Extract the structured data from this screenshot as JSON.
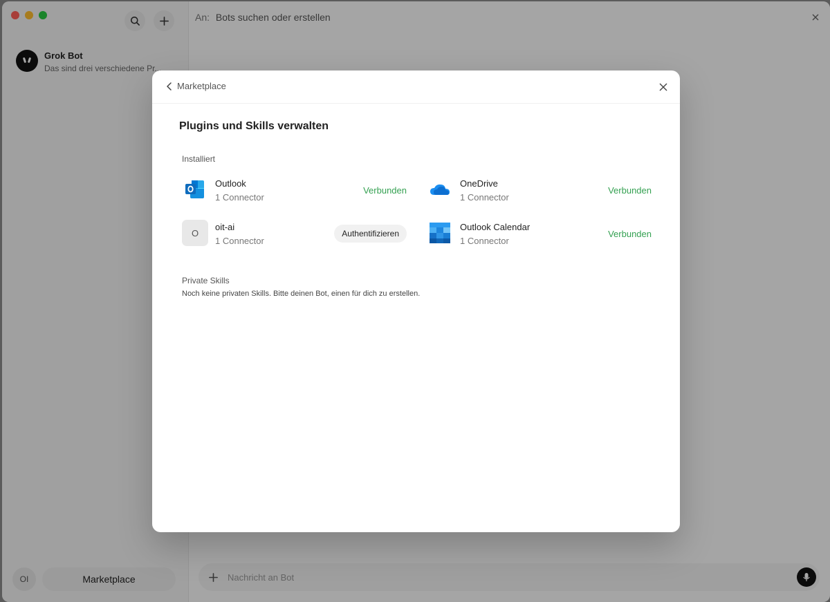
{
  "sidebar": {
    "chat_item": {
      "title": "Grok Bot",
      "preview": "Das sind drei verschiedene Pr..."
    },
    "user_avatar": "OI",
    "marketplace_button": "Marketplace"
  },
  "main": {
    "to_label": "An:",
    "to_placeholder": "Bots suchen oder erstellen",
    "composer_placeholder": "Nachricht an Bot"
  },
  "dialog": {
    "back_label": "Marketplace",
    "title": "Plugins und Skills verwalten",
    "installed_label": "Installiert",
    "plugins": [
      {
        "name": "Outlook",
        "sub": "1 Connector",
        "status": "Verbunden",
        "icon": "outlook-icon"
      },
      {
        "name": "OneDrive",
        "sub": "1 Connector",
        "status": "Verbunden",
        "icon": "onedrive-icon"
      },
      {
        "name": "oit-ai",
        "sub": "1 Connector",
        "action": "Authentifizieren",
        "icon_letter": "O"
      },
      {
        "name": "Outlook Calendar",
        "sub": "1 Connector",
        "status": "Verbunden",
        "icon": "outlook-calendar-icon"
      }
    ],
    "private_label": "Private Skills",
    "private_empty": "Noch keine privaten Skills. Bitte deinen Bot, einen für dich zu erstellen."
  },
  "colors": {
    "connected": "#35a152",
    "outlook_blue": "#0f6cbd",
    "onedrive_blue": "#1c8ef0"
  }
}
